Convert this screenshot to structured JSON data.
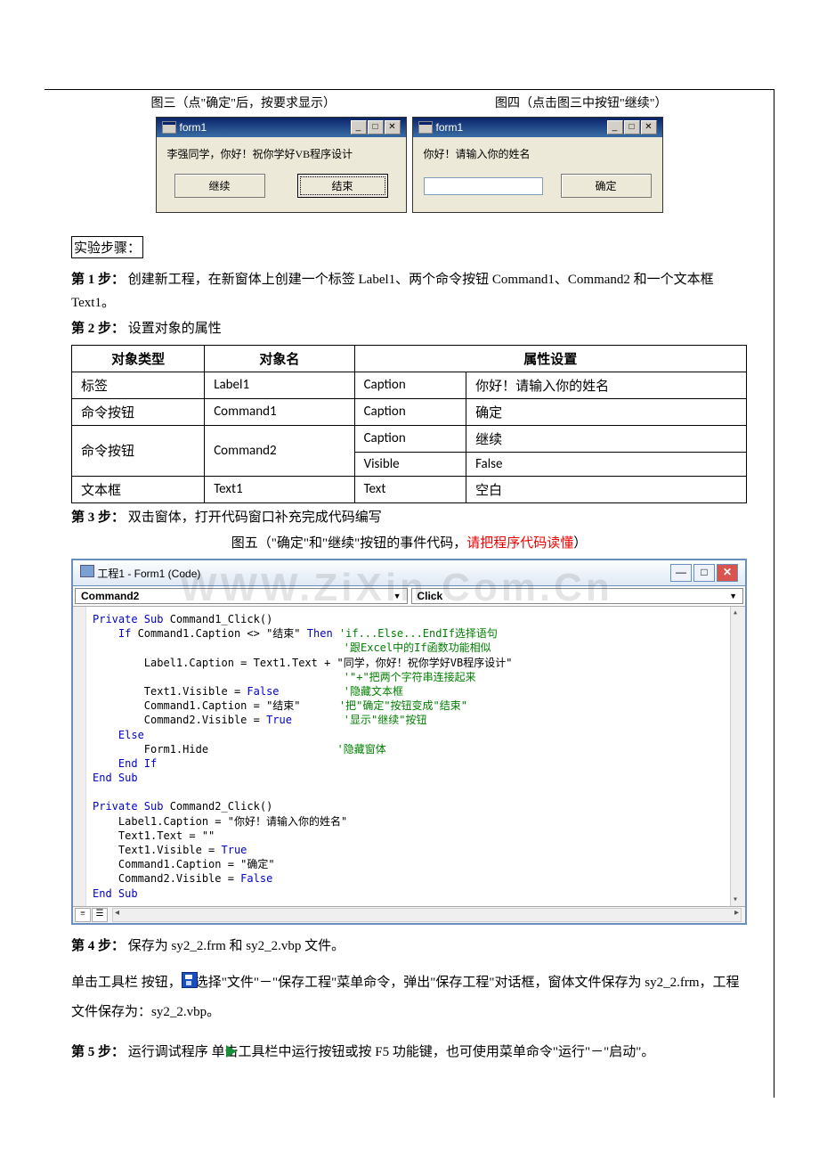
{
  "captions": {
    "fig3": "图三（点\"确定\"后，按要求显示）",
    "fig4": "图四（点击图三中按钮\"继续\"）"
  },
  "form_left": {
    "title": "form1",
    "label": "李强同学，你好！祝你学好VB程序设计",
    "btn_continue": "继续",
    "btn_end": "结束"
  },
  "form_right": {
    "title": "form1",
    "label": "你好！请输入你的姓名",
    "btn_ok": "确定"
  },
  "steps_heading": "实验步骤：",
  "step1_prefix": "第 1 步：",
  "step1_text": "   创建新工程，在新窗体上创建一个标签 Label1、两个命令按钮 Command1、Command2 和一个文本框 Text1。",
  "step2_prefix": "第 2 步：",
  "step2_text": " 设置对象的属性",
  "table": {
    "headers": {
      "type": "对象类型",
      "name": "对象名",
      "prop": "属性设置"
    },
    "rows": [
      {
        "type": "标签",
        "name": "Label1",
        "prop": "Caption",
        "value": "你好！请输入你的姓名"
      },
      {
        "type": "命令按钮",
        "name": "Command1",
        "prop": "Caption",
        "value": "确定"
      },
      {
        "type": "命令按钮",
        "name": "Command2",
        "prop1": "Caption",
        "value1": "继续",
        "prop2": "Visible",
        "value2": "False"
      },
      {
        "type": "文本框",
        "name": "Text1",
        "prop": "Text",
        "value": "空白"
      }
    ]
  },
  "step3_prefix": "第 3 步：",
  "step3_text": " 双击窗体，打开代码窗口补充完成代码编写",
  "fig5_caption_a": "图五（\"确定\"和\"继续\"按钮的事件代码，",
  "fig5_caption_b": "请把程序代码读懂",
  "fig5_caption_c": "）",
  "code_window": {
    "title": "工程1 - Form1 (Code)",
    "object": "Command2",
    "proc": "Click"
  },
  "code": {
    "l1a": "Private Sub",
    "l1b": " Command1_Click()",
    "l2a": "    If",
    "l2b": " Command1.Caption <> \"结束\" ",
    "l2c": "Then ",
    "l2d": "'if...Else...EndIf选择语句",
    "l3a": "                                       ",
    "l3b": "'跟Excel中的If函数功能相似",
    "l4a": "        Label1.Caption = Text1.Text + \"同学，你好！祝你学好VB程序设计\"",
    "l5a": "                                       ",
    "l5b": "'\"+\"把两个字符串连接起来",
    "l6a": "        Text1.Visible = ",
    "l6b": "False          ",
    "l6c": "'隐藏文本框",
    "l7a": "        Command1.Caption = \"结束\"      ",
    "l7b": "'把\"确定\"按钮变成\"结束\"",
    "l8a": "        Command2.Visible = ",
    "l8b": "True        ",
    "l8c": "'显示\"继续\"按钮",
    "l9a": "    Else",
    "l10a": "        Form1.Hide                    ",
    "l10b": "'隐藏窗体",
    "l11a": "    End If",
    "l12a": "End Sub",
    "l13": "",
    "l14a": "Private Sub",
    "l14b": " Command2_Click()",
    "l15a": "    Label1.Caption = \"你好！请输入你的姓名\"",
    "l16a": "    Text1.Text = \"\"",
    "l17a": "    Text1.Visible = ",
    "l17b": "True",
    "l18a": "    Command1.Caption = \"确定\"",
    "l19a": "    Command2.Visible = ",
    "l19b": "False",
    "l20a": "End Sub"
  },
  "step4_prefix": "第 4 步：",
  "step4_text": " 保存为 sy2_2.frm 和 sy2_2.vbp 文件。",
  "step4_para": "      单击工具栏      按钮，或选择\"文件\"－\"保存工程\"菜单命令，弹出\"保存工程\"对话框，窗体文件保存为 sy2_2.frm，工程文件保存为：sy2_2.vbp。",
  "step5_prefix": "第 5 步：",
  "step5_text_a": " 运行调试程序      单击工具栏中运行按钮或按 F5 功能键，也可使用菜单命令\"运行\"－\"启动\"。",
  "watermark": "WWW.ZiXin.Com.Cn"
}
